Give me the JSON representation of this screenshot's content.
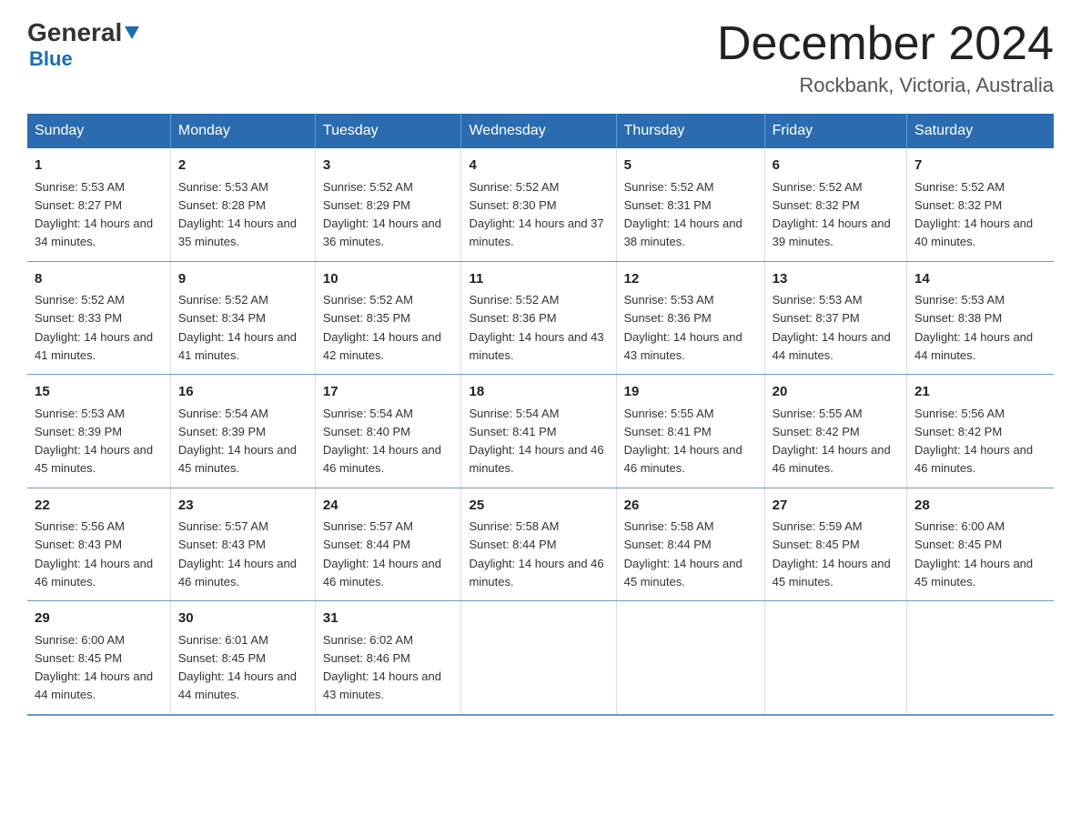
{
  "logo": {
    "line1": "General",
    "triangle": "▼",
    "line2": "Blue"
  },
  "title": "December 2024",
  "subtitle": "Rockbank, Victoria, Australia",
  "days_of_week": [
    "Sunday",
    "Monday",
    "Tuesday",
    "Wednesday",
    "Thursday",
    "Friday",
    "Saturday"
  ],
  "weeks": [
    [
      {
        "num": "1",
        "sunrise": "5:53 AM",
        "sunset": "8:27 PM",
        "daylight": "14 hours and 34 minutes."
      },
      {
        "num": "2",
        "sunrise": "5:53 AM",
        "sunset": "8:28 PM",
        "daylight": "14 hours and 35 minutes."
      },
      {
        "num": "3",
        "sunrise": "5:52 AM",
        "sunset": "8:29 PM",
        "daylight": "14 hours and 36 minutes."
      },
      {
        "num": "4",
        "sunrise": "5:52 AM",
        "sunset": "8:30 PM",
        "daylight": "14 hours and 37 minutes."
      },
      {
        "num": "5",
        "sunrise": "5:52 AM",
        "sunset": "8:31 PM",
        "daylight": "14 hours and 38 minutes."
      },
      {
        "num": "6",
        "sunrise": "5:52 AM",
        "sunset": "8:32 PM",
        "daylight": "14 hours and 39 minutes."
      },
      {
        "num": "7",
        "sunrise": "5:52 AM",
        "sunset": "8:32 PM",
        "daylight": "14 hours and 40 minutes."
      }
    ],
    [
      {
        "num": "8",
        "sunrise": "5:52 AM",
        "sunset": "8:33 PM",
        "daylight": "14 hours and 41 minutes."
      },
      {
        "num": "9",
        "sunrise": "5:52 AM",
        "sunset": "8:34 PM",
        "daylight": "14 hours and 41 minutes."
      },
      {
        "num": "10",
        "sunrise": "5:52 AM",
        "sunset": "8:35 PM",
        "daylight": "14 hours and 42 minutes."
      },
      {
        "num": "11",
        "sunrise": "5:52 AM",
        "sunset": "8:36 PM",
        "daylight": "14 hours and 43 minutes."
      },
      {
        "num": "12",
        "sunrise": "5:53 AM",
        "sunset": "8:36 PM",
        "daylight": "14 hours and 43 minutes."
      },
      {
        "num": "13",
        "sunrise": "5:53 AM",
        "sunset": "8:37 PM",
        "daylight": "14 hours and 44 minutes."
      },
      {
        "num": "14",
        "sunrise": "5:53 AM",
        "sunset": "8:38 PM",
        "daylight": "14 hours and 44 minutes."
      }
    ],
    [
      {
        "num": "15",
        "sunrise": "5:53 AM",
        "sunset": "8:39 PM",
        "daylight": "14 hours and 45 minutes."
      },
      {
        "num": "16",
        "sunrise": "5:54 AM",
        "sunset": "8:39 PM",
        "daylight": "14 hours and 45 minutes."
      },
      {
        "num": "17",
        "sunrise": "5:54 AM",
        "sunset": "8:40 PM",
        "daylight": "14 hours and 46 minutes."
      },
      {
        "num": "18",
        "sunrise": "5:54 AM",
        "sunset": "8:41 PM",
        "daylight": "14 hours and 46 minutes."
      },
      {
        "num": "19",
        "sunrise": "5:55 AM",
        "sunset": "8:41 PM",
        "daylight": "14 hours and 46 minutes."
      },
      {
        "num": "20",
        "sunrise": "5:55 AM",
        "sunset": "8:42 PM",
        "daylight": "14 hours and 46 minutes."
      },
      {
        "num": "21",
        "sunrise": "5:56 AM",
        "sunset": "8:42 PM",
        "daylight": "14 hours and 46 minutes."
      }
    ],
    [
      {
        "num": "22",
        "sunrise": "5:56 AM",
        "sunset": "8:43 PM",
        "daylight": "14 hours and 46 minutes."
      },
      {
        "num": "23",
        "sunrise": "5:57 AM",
        "sunset": "8:43 PM",
        "daylight": "14 hours and 46 minutes."
      },
      {
        "num": "24",
        "sunrise": "5:57 AM",
        "sunset": "8:44 PM",
        "daylight": "14 hours and 46 minutes."
      },
      {
        "num": "25",
        "sunrise": "5:58 AM",
        "sunset": "8:44 PM",
        "daylight": "14 hours and 46 minutes."
      },
      {
        "num": "26",
        "sunrise": "5:58 AM",
        "sunset": "8:44 PM",
        "daylight": "14 hours and 45 minutes."
      },
      {
        "num": "27",
        "sunrise": "5:59 AM",
        "sunset": "8:45 PM",
        "daylight": "14 hours and 45 minutes."
      },
      {
        "num": "28",
        "sunrise": "6:00 AM",
        "sunset": "8:45 PM",
        "daylight": "14 hours and 45 minutes."
      }
    ],
    [
      {
        "num": "29",
        "sunrise": "6:00 AM",
        "sunset": "8:45 PM",
        "daylight": "14 hours and 44 minutes."
      },
      {
        "num": "30",
        "sunrise": "6:01 AM",
        "sunset": "8:45 PM",
        "daylight": "14 hours and 44 minutes."
      },
      {
        "num": "31",
        "sunrise": "6:02 AM",
        "sunset": "8:46 PM",
        "daylight": "14 hours and 43 minutes."
      },
      null,
      null,
      null,
      null
    ]
  ],
  "colors": {
    "header_bg": "#2b6cb0",
    "header_text": "#ffffff",
    "border": "#6699cc",
    "accent_blue": "#1a6eb5"
  }
}
